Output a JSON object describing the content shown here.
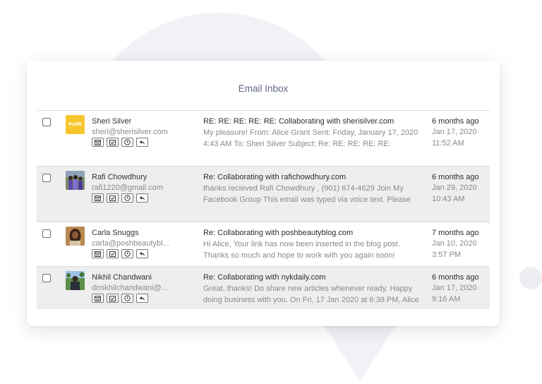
{
  "inbox": {
    "title": "Email Inbox",
    "emails": [
      {
        "name": "Sheri Silver",
        "email": "sheri@sherisilver.com",
        "avatar": "logo",
        "avatar_text": "Profit",
        "subject": "RE: RE: RE: RE: RE: Collaborating with sherisilver.com",
        "preview": "My pleasure!   From: Alice Grant Sent: Friday, January 17, 2020 4:43 AM To: Sheri Silver Subject: Re: RE: RE: RE: RE:",
        "age": "6 months ago",
        "date": "Jan 17, 2020",
        "time": "11:52 AM"
      },
      {
        "name": "Rafi Chowdhury",
        "email": "rafi1220@gmail.com",
        "avatar": "photo-group",
        "subject": "Re: Collaborating with rafichowdhury.com",
        "preview": "thanks recieved Rafi Chowdhury , (901) 674-4629 Join My Facebook Group This email was typed via voice text. Please",
        "age": "6 months ago",
        "date": "Jan 29, 2020",
        "time": "10:43 AM"
      },
      {
        "name": "Carla Snuggs",
        "email": "carla@poshbeautybl...",
        "avatar": "photo-portrait",
        "subject": "Re: Collaborating with poshbeautyblog.com",
        "preview": "Hi Alice, Your link has now been inserted in the blog post. Thanks so much and hope to work with you again soon!",
        "age": "7 months ago",
        "date": "Jan 10, 2020",
        "time": "3:57 PM"
      },
      {
        "name": "Nikhil Chandwani",
        "email": "drnikhilchandwani@...",
        "avatar": "photo-outdoor",
        "subject": "Re: Collaborating with nykdaily.com",
        "preview": "Great, thanks! Do share new articles whenever ready. Happy doing business with you. On Fri, 17 Jan 2020 at 6:38 PM, Alice",
        "age": "6 months ago",
        "date": "Jan 17, 2020",
        "time": "9:16 AM"
      }
    ],
    "action_icons": [
      "calendar-icon",
      "checklist-icon",
      "clock-icon",
      "reply-icon"
    ]
  }
}
